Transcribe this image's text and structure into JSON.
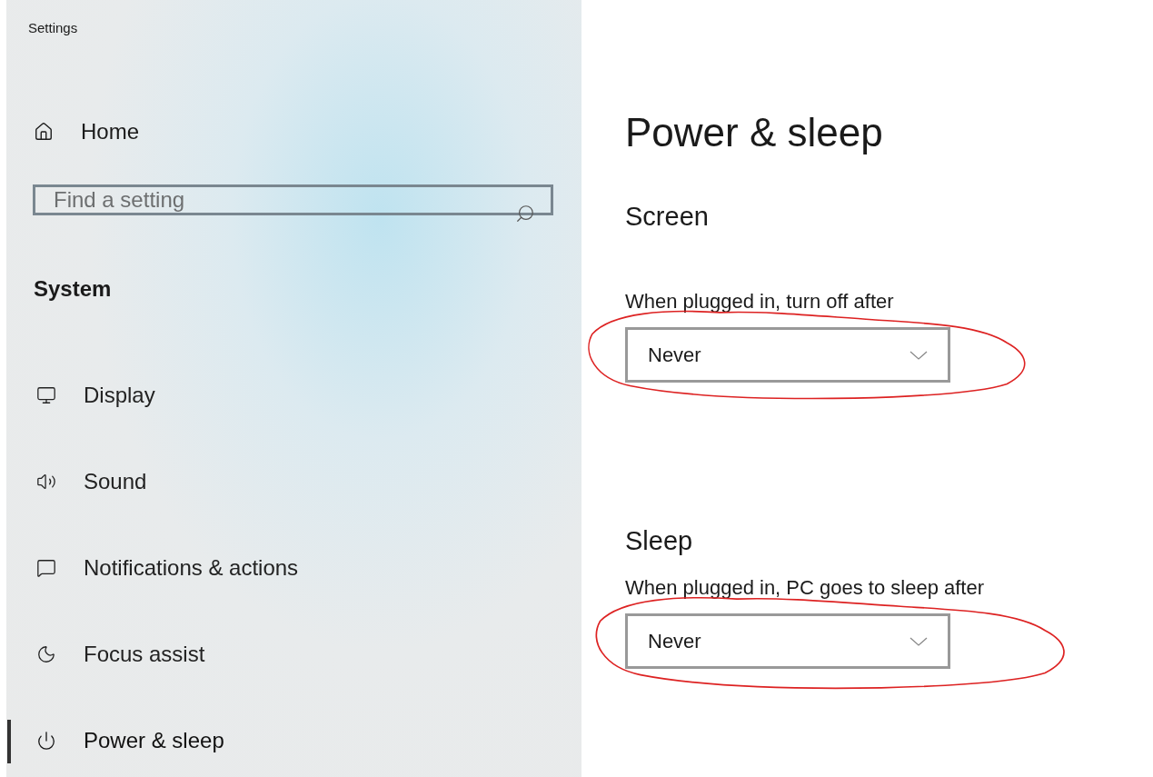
{
  "window": {
    "title": "Settings"
  },
  "sidebar": {
    "home": "Home",
    "search": {
      "placeholder": "Find a setting"
    },
    "group": "System",
    "items": [
      {
        "label": "Display",
        "selected": false
      },
      {
        "label": "Sound",
        "selected": false
      },
      {
        "label": "Notifications & actions",
        "selected": false
      },
      {
        "label": "Focus assist",
        "selected": false
      },
      {
        "label": "Power & sleep",
        "selected": true
      }
    ]
  },
  "page": {
    "title": "Power & sleep",
    "sections": [
      {
        "heading": "Screen",
        "label": "When plugged in, turn off after",
        "value": "Never",
        "circled": true
      },
      {
        "heading": "Sleep",
        "label": "When plugged in, PC goes to sleep after",
        "value": "Never",
        "circled": true
      }
    ]
  }
}
